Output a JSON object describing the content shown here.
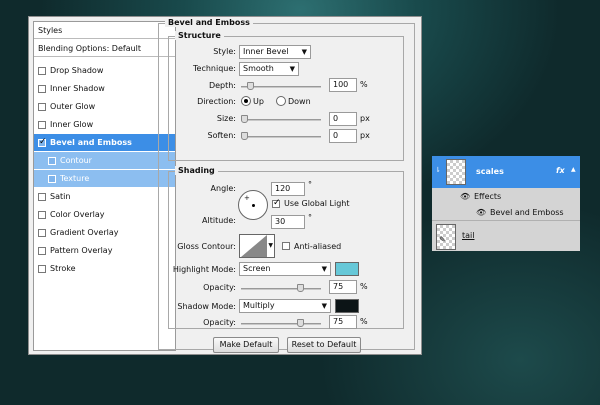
{
  "styles_panel": {
    "header": "Styles",
    "blending": "Blending Options: Default",
    "items": [
      {
        "label": "Drop Shadow",
        "checked": false
      },
      {
        "label": "Inner Shadow",
        "checked": false
      },
      {
        "label": "Outer Glow",
        "checked": false
      },
      {
        "label": "Inner Glow",
        "checked": false
      },
      {
        "label": "Bevel and Emboss",
        "checked": true
      },
      {
        "label": "Contour",
        "checked": false
      },
      {
        "label": "Texture",
        "checked": false
      },
      {
        "label": "Satin",
        "checked": false
      },
      {
        "label": "Color Overlay",
        "checked": false
      },
      {
        "label": "Gradient Overlay",
        "checked": false
      },
      {
        "label": "Pattern Overlay",
        "checked": false
      },
      {
        "label": "Stroke",
        "checked": false
      }
    ]
  },
  "bevel": {
    "title": "Bevel and Emboss",
    "structure": {
      "legend": "Structure",
      "style_label": "Style:",
      "style_value": "Inner Bevel",
      "technique_label": "Technique:",
      "technique_value": "Smooth",
      "depth_label": "Depth:",
      "depth_value": "100",
      "depth_unit": "%",
      "direction_label": "Direction:",
      "up_label": "Up",
      "down_label": "Down",
      "size_label": "Size:",
      "size_value": "0",
      "size_unit": "px",
      "soften_label": "Soften:",
      "soften_value": "0",
      "soften_unit": "px"
    },
    "shading": {
      "legend": "Shading",
      "angle_label": "Angle:",
      "angle_value": "120",
      "angle_unit": "°",
      "global_light_label": "Use Global Light",
      "altitude_label": "Altitude:",
      "altitude_value": "30",
      "altitude_unit": "°",
      "gloss_label": "Gloss Contour:",
      "anti_aliased_label": "Anti-aliased",
      "highlight_label": "Highlight Mode:",
      "highlight_value": "Screen",
      "highlight_color": "#66c8d8",
      "h_opacity_label": "Opacity:",
      "h_opacity_value": "75",
      "h_opacity_unit": "%",
      "shadow_label": "Shadow Mode:",
      "shadow_value": "Multiply",
      "shadow_color": "#0c1416",
      "s_opacity_label": "Opacity:",
      "s_opacity_value": "75",
      "s_opacity_unit": "%"
    },
    "make_default": "Make Default",
    "reset_default": "Reset to Default"
  },
  "layers": {
    "scales": "scales",
    "fx": "fx",
    "effects": "Effects",
    "bevel_effect": "Bevel and Emboss",
    "tail": "tail"
  }
}
